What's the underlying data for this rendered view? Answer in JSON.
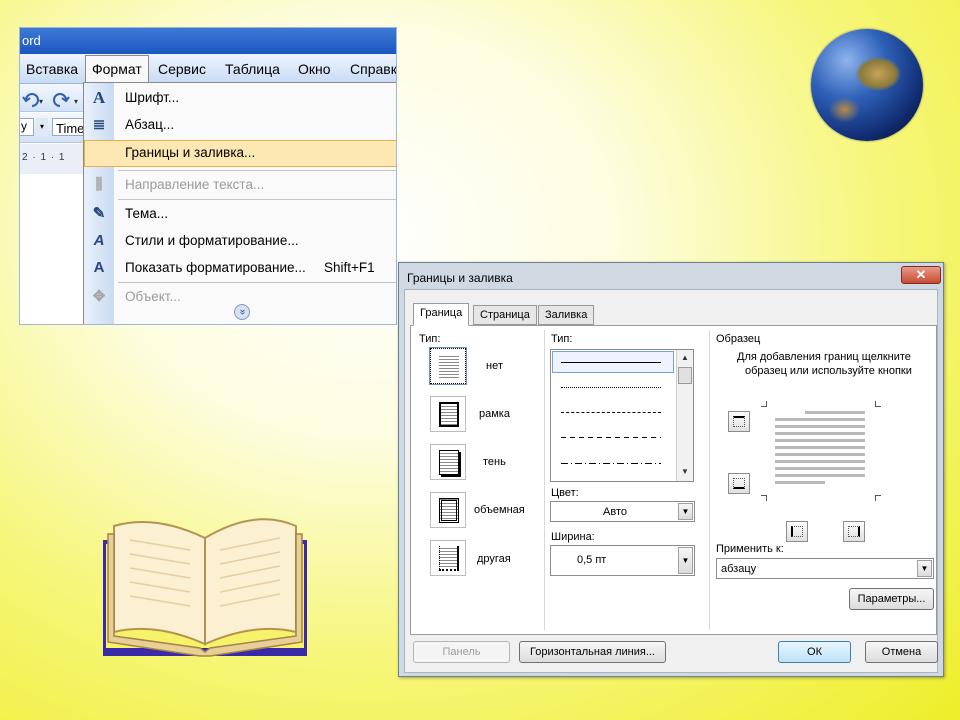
{
  "word": {
    "title_fragment": "ord",
    "menubar": [
      "Вставка",
      "Формат",
      "Сервис",
      "Таблица",
      "Окно",
      "Справк"
    ],
    "toolbar2_text": "Time",
    "ruler_text": "2 · 1 · 1",
    "format_menu": {
      "items": [
        {
          "label": "Шрифт...",
          "icon": "font-icon",
          "glyph": "A"
        },
        {
          "label": "Абзац...",
          "icon": "paragraph-icon",
          "glyph": "≣"
        },
        {
          "label": "Границы и заливка...",
          "icon": "borders-icon",
          "glyph": ""
        },
        {
          "label": "Направление текста...",
          "icon": "text-direction-icon",
          "glyph": "⫼"
        },
        {
          "label": "Тема...",
          "icon": "theme-icon",
          "glyph": "✎"
        },
        {
          "label": "Стили и форматирование...",
          "icon": "styles-icon",
          "glyph": "A"
        },
        {
          "label": "Показать форматирование...",
          "icon": "reveal-formatting-icon",
          "glyph": "A"
        },
        {
          "label": "Объект...",
          "icon": "object-icon",
          "glyph": "✥"
        }
      ],
      "shortcut": "Shift+F1",
      "expand_glyph": "»"
    }
  },
  "dialog": {
    "title": "Границы и заливка",
    "close_glyph": "✕",
    "tabs": [
      "Граница",
      "Страница",
      "Заливка"
    ],
    "setting_label": "Тип:",
    "presets": [
      "нет",
      "рамка",
      "тень",
      "объемная",
      "другая"
    ],
    "style_label": "Тип:",
    "color_label": "Цвет:",
    "color_value": "Авто",
    "width_label": "Ширина:",
    "width_value": "0,5 пт",
    "preview_label": "Образец",
    "preview_hint_1": "Для добавления границ щелкните",
    "preview_hint_2": "образец или используйте кнопки",
    "apply_label": "Применить к:",
    "apply_value": "абзацу",
    "options_button": "Параметры...",
    "toolbar_button": "Панель",
    "hline_button": "Горизонтальная линия...",
    "ok_button": "ОК",
    "cancel_button": "Отмена"
  },
  "colors": {
    "background": "#f3f36a",
    "menu_highlight": "#fde8b4",
    "titlebar": "#2a63c8",
    "book_frame": "#3b2aa8"
  }
}
